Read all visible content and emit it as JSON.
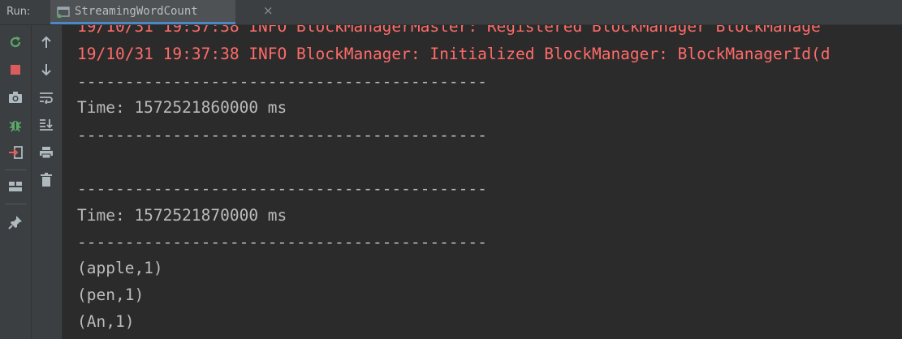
{
  "header": {
    "run_label": "Run:",
    "tab_title": "StreamingWordCount",
    "tab_close": "×"
  },
  "toolbar_left": {
    "rerun": "rerun-icon",
    "stop": "stop-icon",
    "screenshot": "camera-icon",
    "debug": "bug-icon",
    "exit": "exit-icon",
    "layout": "layout-icon",
    "pin": "pin-icon"
  },
  "toolbar_right": {
    "up": "arrow-up-icon",
    "down": "arrow-down-icon",
    "wrap": "soft-wrap-icon",
    "scroll_end": "scroll-to-end-icon",
    "print": "print-icon",
    "clear": "trash-icon"
  },
  "console": {
    "lines": [
      "19/10/31 19:37:38 INFO BlockManagerMaster: Registered BlockManager BlockManage",
      "19/10/31 19:37:38 INFO BlockManager: Initialized BlockManager: BlockManagerId(d",
      "-------------------------------------------",
      "Time: 1572521860000 ms",
      "-------------------------------------------",
      "",
      "-------------------------------------------",
      "Time: 1572521870000 ms",
      "-------------------------------------------",
      "(apple,1)",
      "(pen,1)",
      "(An,1)"
    ]
  },
  "colors": {
    "background": "#2b2b2b",
    "toolbar": "#3c3f41",
    "log_text": "#ff6b68",
    "output_text": "#bbbbbb",
    "tab_accent": "#4a88c7"
  }
}
